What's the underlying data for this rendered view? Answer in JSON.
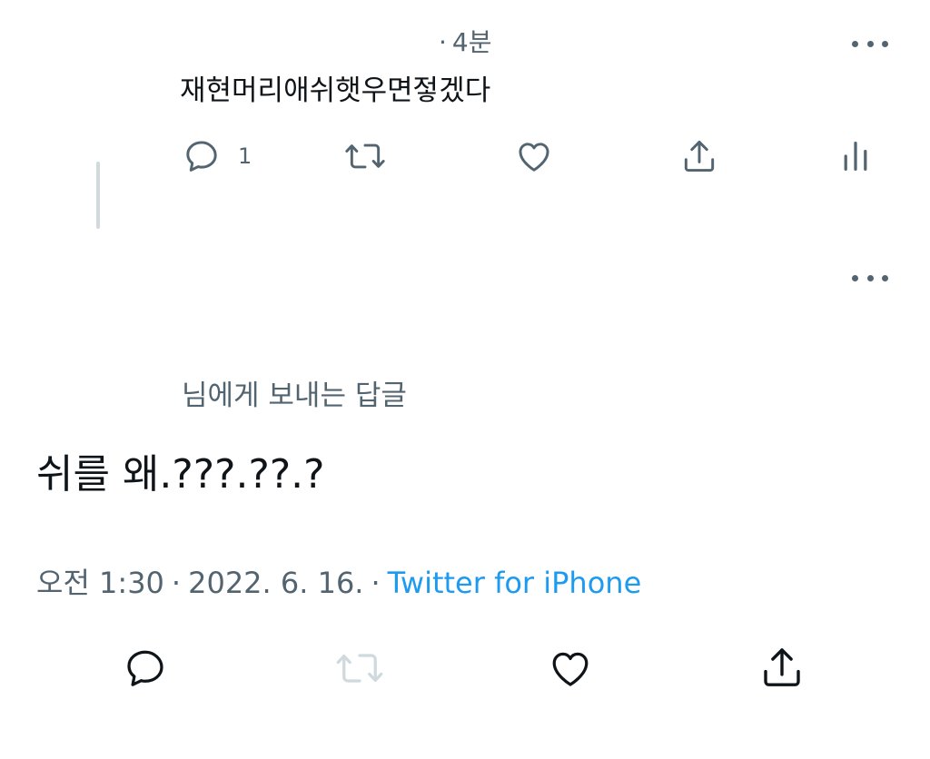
{
  "parent_tweet": {
    "time_ago": "4분",
    "text": "재현머리애쉬햇우면젛겠다",
    "reply_count": "1"
  },
  "main_tweet": {
    "reply_to": "님에게 보내는 답글",
    "text": "쉬를 왜.???.??.?",
    "time": "오전 1:30",
    "separator": "·",
    "date": "2022. 6. 16.",
    "source": "Twitter for iPhone"
  },
  "icons": {
    "reply": "reply-icon",
    "retweet": "retweet-icon",
    "like": "heart-icon",
    "share": "share-icon",
    "analytics": "analytics-icon",
    "more": "more-icon"
  },
  "colors": {
    "text": "#0f1419",
    "secondary": "#536471",
    "link": "#1d9bf0",
    "disabled": "#cfd9de"
  }
}
